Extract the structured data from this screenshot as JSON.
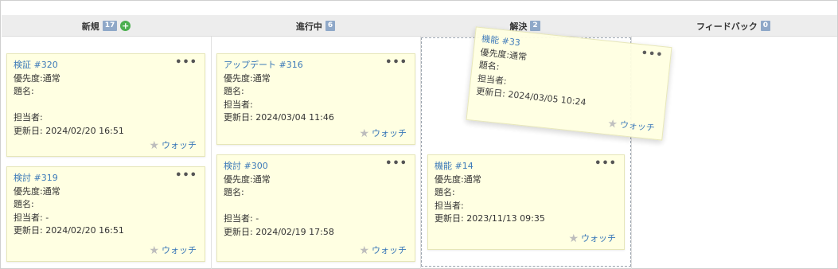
{
  "columns": [
    {
      "name": "新規",
      "count": "17",
      "add_label": "+"
    },
    {
      "name": "進行中",
      "count": "6"
    },
    {
      "name": "解決",
      "count": "2"
    },
    {
      "name": "フィードバック",
      "count": "0"
    }
  ],
  "fields": {
    "priority": "優先度:",
    "subject": "題名:",
    "assignee": "担当者:",
    "updated": "更新日:"
  },
  "menu_label": "•••",
  "watch_label": "ウォッチ",
  "cards": [
    {
      "title": "検証 #320",
      "priority": "通常",
      "subject": "",
      "assignee": "",
      "updated": "2024/02/20 16:51"
    },
    {
      "title": "検討 #319",
      "priority": "通常",
      "subject": "",
      "assignee": "-",
      "updated": "2024/02/20 16:51"
    },
    {
      "title": "アップデート #316",
      "priority": "通常",
      "subject": "",
      "assignee": "",
      "updated": "2024/03/04 11:46"
    },
    {
      "title": "検討 #300",
      "priority": "通常",
      "subject": "",
      "assignee": "-",
      "updated": "2024/02/19 17:58"
    },
    {
      "title": "機能 #33",
      "priority": "通常",
      "subject": "",
      "assignee": "",
      "updated": "2024/03/05 10:24"
    },
    {
      "title": "機能 #14",
      "priority": "通常",
      "subject": "",
      "assignee": "",
      "updated": "2023/11/13 09:35"
    }
  ]
}
